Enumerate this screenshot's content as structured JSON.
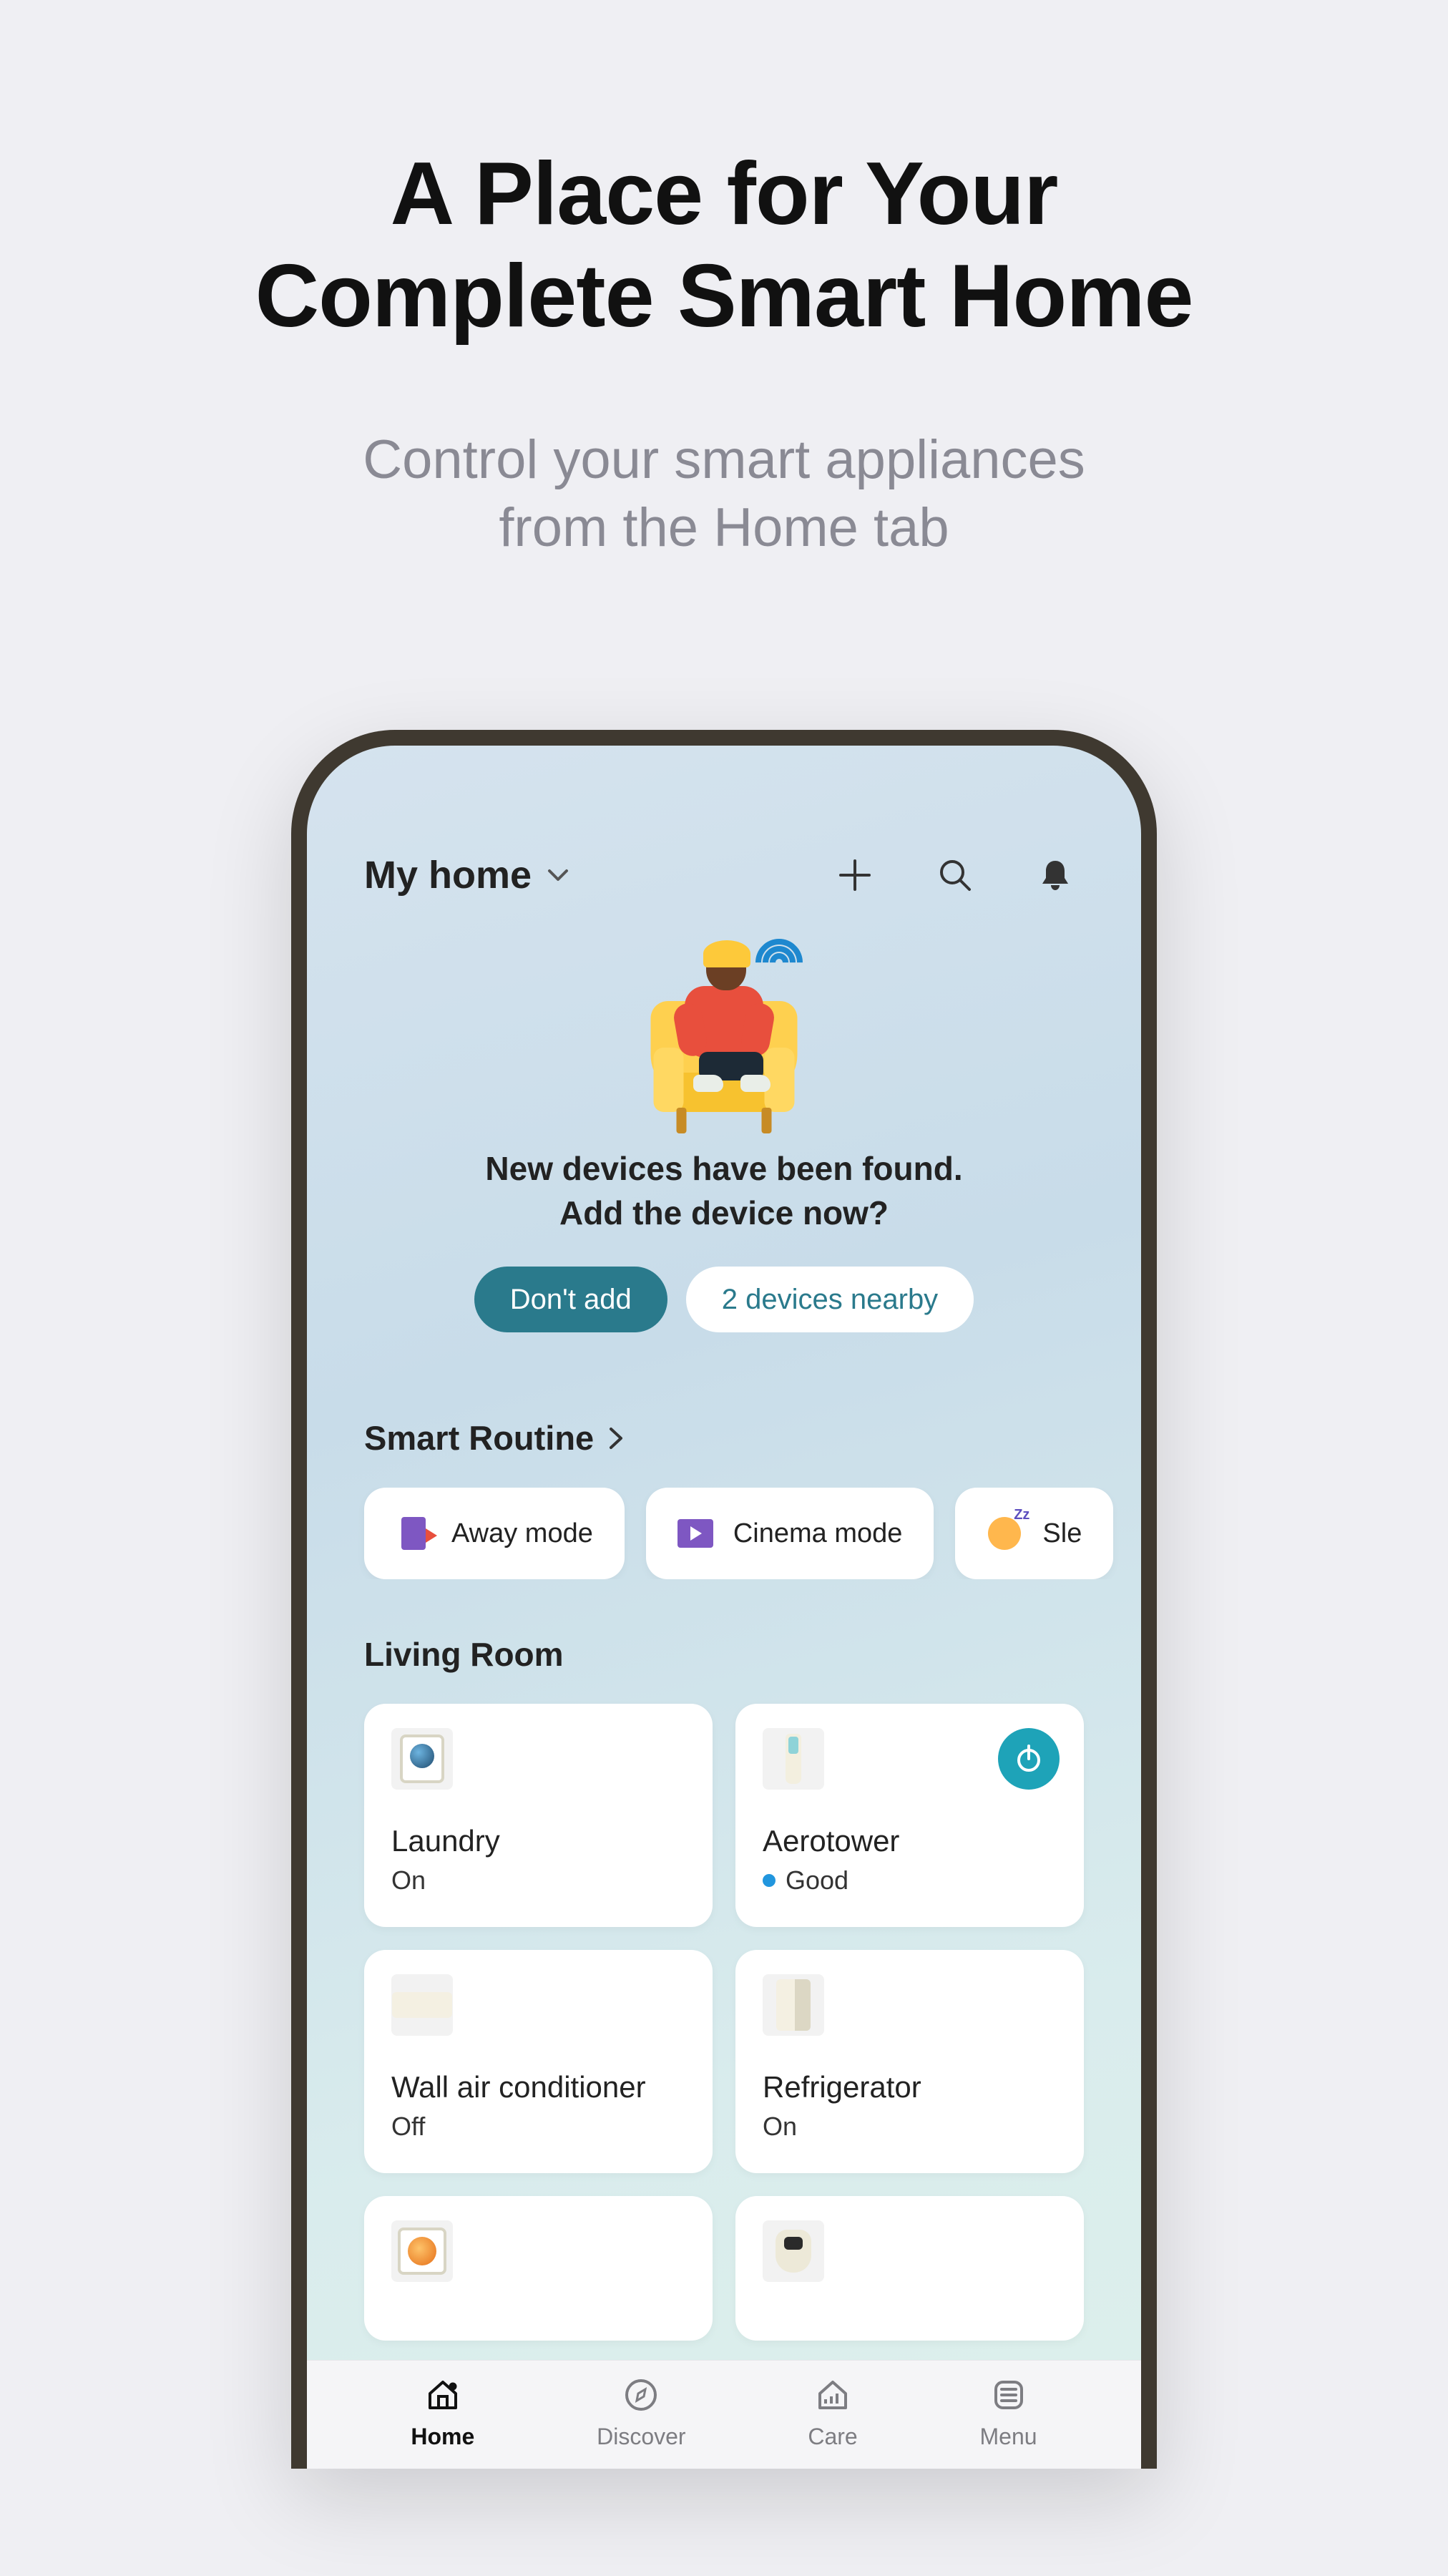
{
  "hero": {
    "title_line1": "A Place for Your",
    "title_line2": "Complete Smart Home",
    "sub_line1": "Control your smart appliances",
    "sub_line2": "from the Home tab"
  },
  "topbar": {
    "home_label": "My home"
  },
  "banner": {
    "line1": "New devices have been found.",
    "line2": "Add the device now?",
    "btn_dismiss": "Don't add",
    "btn_action": "2 devices nearby"
  },
  "routines": {
    "header": "Smart Routine",
    "items": [
      {
        "label": "Away mode"
      },
      {
        "label": "Cinema mode"
      },
      {
        "label": "Sle"
      }
    ]
  },
  "room": {
    "title": "Living Room",
    "devices": [
      {
        "name": "Laundry",
        "status": "On"
      },
      {
        "name": "Aerotower",
        "status": "Good",
        "status_dot": "good",
        "power": true
      },
      {
        "name": "Wall air conditioner",
        "status": "Off"
      },
      {
        "name": "Refrigerator",
        "status": "On"
      }
    ]
  },
  "bottom_nav": {
    "items": [
      {
        "label": "Home"
      },
      {
        "label": "Discover"
      },
      {
        "label": "Care"
      },
      {
        "label": "Menu"
      }
    ]
  }
}
